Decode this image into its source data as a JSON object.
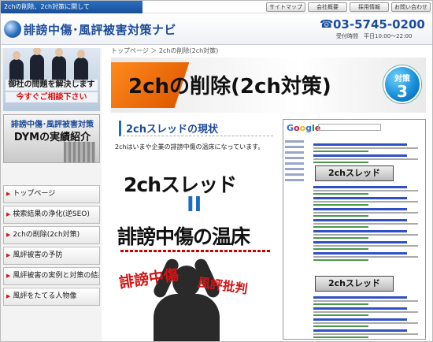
{
  "topbar": {
    "tagline": "2chの削除、2ch対策に関して",
    "nav": [
      "サイトマップ",
      "会社概要",
      "採用情報",
      "お問い合わせ"
    ]
  },
  "header": {
    "logo_text": "誹謗中傷･風評被害対策ナビ",
    "phone": "03-5745-0200",
    "hours": "受付時間　平日10:00～22:00"
  },
  "sidebar": {
    "promo_line1": "御社の問題を解決します",
    "promo_line2": "今すぐご相談下さい",
    "dym_line1": "誹謗中傷･風評被害対策",
    "dym_line2": "DYMの実績紹介",
    "menu": [
      "トップページ",
      "検索結果の浄化(逆SEO)",
      "2chの削除(2ch対策)",
      "風評被害の予防",
      "風評被害の実例と対策の結果",
      "風評をたてる人物像"
    ]
  },
  "main": {
    "breadcrumb": "トップページ ＞ 2chの削除(2ch対策)",
    "banner_title": "2chの削除(2ch対策)",
    "badge_label": "対策",
    "badge_number": "3",
    "section_heading": "2chスレッドの現状",
    "section_text": "2chはいまや企業の誹謗中傷の温床になっています。",
    "art": {
      "line1": "2chスレッド",
      "equals": "II",
      "line2": "誹謗中傷の温床",
      "red1": "誹謗中傷",
      "red2": "風評批判"
    },
    "google": {
      "logo": "Google",
      "label1": "2chスレッド",
      "label2": "2chスレッド"
    }
  },
  "colors": {
    "brand_blue": "#1d4c9a",
    "accent_orange": "#f07a10",
    "alert_red": "#d31414"
  }
}
